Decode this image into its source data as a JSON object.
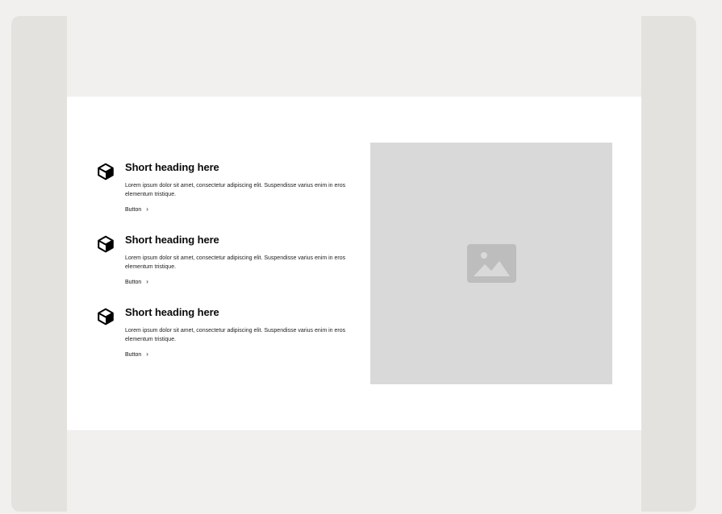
{
  "features": [
    {
      "icon": "cube-icon",
      "heading": "Short heading here",
      "text": "Lorem ipsum dolor sit amet, consectetur adipiscing elit. Suspendisse varius enim in eros elementum tristique.",
      "button_label": "Button",
      "button_icon": "chevron-right-icon"
    },
    {
      "icon": "cube-icon",
      "heading": "Short heading here",
      "text": "Lorem ipsum dolor sit amet, consectetur adipiscing elit. Suspendisse varius enim in eros elementum tristique.",
      "button_label": "Button",
      "button_icon": "chevron-right-icon"
    },
    {
      "icon": "cube-icon",
      "heading": "Short heading here",
      "text": "Lorem ipsum dolor sit amet, consectetur adipiscing elit. Suspendisse varius enim in eros elementum tristique.",
      "button_label": "Button",
      "button_icon": "chevron-right-icon"
    }
  ],
  "media": {
    "icon": "image-placeholder-icon"
  },
  "colors": {
    "page_background": "#f1f0ee",
    "frame_background": "#e3e2de",
    "section_background": "#ffffff",
    "placeholder_background": "#d9d9d9",
    "placeholder_icon": "#bdbdbd",
    "text": "#0a0a0a"
  }
}
